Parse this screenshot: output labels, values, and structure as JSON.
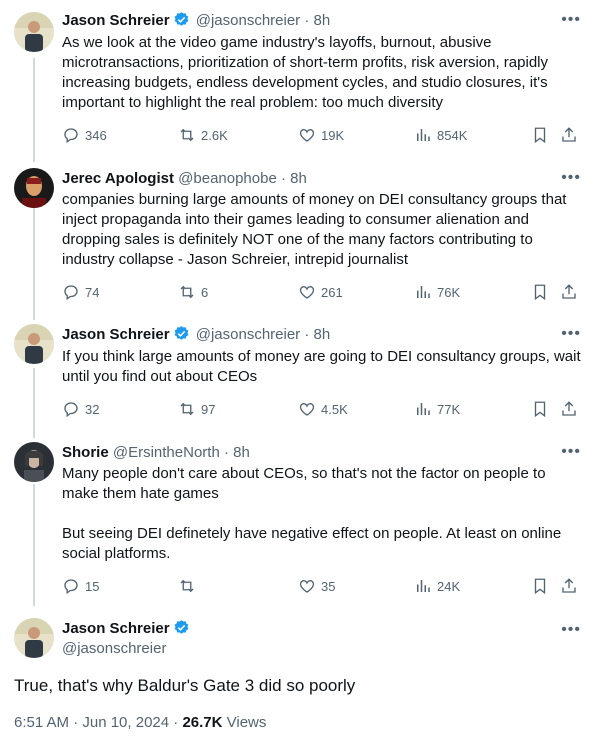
{
  "thread": [
    {
      "name": "Jason Schreier",
      "handle": "@jasonschreier",
      "time": "8h",
      "verified": true,
      "text": "As we look at the video game industry's layoffs, burnout, abusive microtransactions, prioritization of short-term profits, risk aversion, rapidly increasing budgets, endless development cycles, and studio closures, it's important to highlight the real problem: too much diversity",
      "stats": {
        "replies": "346",
        "reposts": "2.6K",
        "likes": "19K",
        "views": "854K"
      }
    },
    {
      "name": "Jerec Apologist",
      "handle": "@beanophobe",
      "time": "8h",
      "verified": false,
      "text": "companies burning large amounts of money on DEI consultancy groups that inject propaganda into their games leading to consumer alienation and dropping sales is definitely NOT one of the many factors contributing to industry collapse - Jason Schreier, intrepid journalist",
      "stats": {
        "replies": "74",
        "reposts": "6",
        "likes": "261",
        "views": "76K"
      }
    },
    {
      "name": "Jason Schreier",
      "handle": "@jasonschreier",
      "time": "8h",
      "verified": true,
      "text": "If you think large amounts of money are going to DEI consultancy groups, wait until you find out about CEOs",
      "stats": {
        "replies": "32",
        "reposts": "97",
        "likes": "4.5K",
        "views": "77K"
      }
    },
    {
      "name": "Shorie",
      "handle": "@ErsintheNorth",
      "time": "8h",
      "verified": false,
      "text": "Many people don't care about CEOs, so that's not the factor on people to make them hate games\n\nBut seeing DEI definetely have negative effect on people. At least on online social platforms.",
      "stats": {
        "replies": "15",
        "reposts": "",
        "likes": "35",
        "views": "24K"
      }
    }
  ],
  "main_tweet": {
    "name": "Jason Schreier",
    "handle": "@jasonschreier",
    "text": "True, that's why Baldur's Gate 3 did so poorly",
    "timestamp": "6:51 AM · Jun 10, 2024 · ",
    "views_count": "26.7K",
    "views_label": "Views"
  },
  "ui": {
    "separator_dot": "·",
    "more_glyph": "•••"
  },
  "colors": {
    "verified_blue": "#1d9bf0",
    "secondary_text": "#536471",
    "thread_line": "#cfd9de"
  }
}
